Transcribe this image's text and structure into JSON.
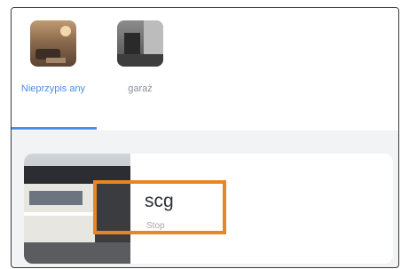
{
  "tabs": [
    {
      "label": "Nieprzypis any",
      "icon": "living-room-thumbnail",
      "selected": true
    },
    {
      "label": "garaż",
      "icon": "garage-thumbnail",
      "selected": false
    }
  ],
  "device": {
    "name": "scg",
    "status": "Stop",
    "image": "house-exterior-image"
  },
  "colors": {
    "accent": "#4a8fe0",
    "highlight": "#e88524",
    "background": "#f2f3f5"
  }
}
